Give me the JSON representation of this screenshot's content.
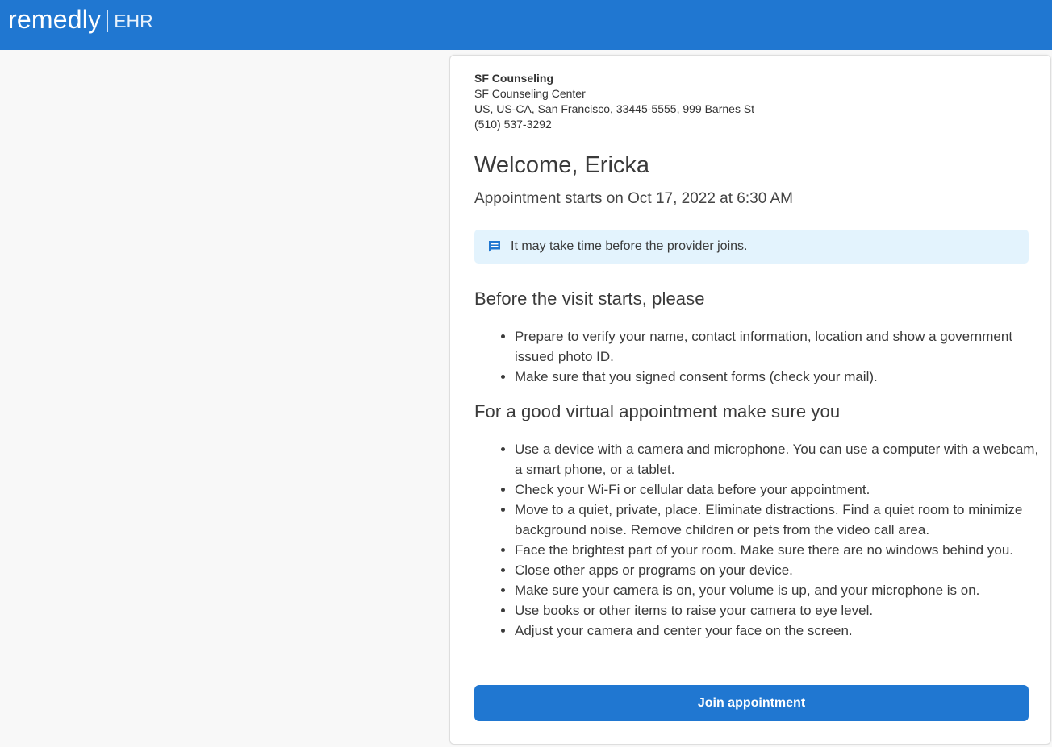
{
  "header": {
    "brand": "remedly",
    "product": "EHR"
  },
  "organization": {
    "name": "SF Counseling",
    "center": "SF Counseling Center",
    "address": "US, US-CA, San Francisco, 33445-5555, 999 Barnes St",
    "phone": "(510) 537-3292"
  },
  "welcome": "Welcome, Ericka",
  "appointment_time": "Appointment starts on Oct 17, 2022 at 6:30 AM",
  "notice": {
    "icon": "message-icon",
    "text": "It may take time before the provider joins."
  },
  "before_visit": {
    "title": "Before the visit starts, please",
    "items": [
      "Prepare to verify your name, contact information, location and show a government issued photo ID.",
      "Make sure that you signed consent forms (check your mail)."
    ]
  },
  "good_appointment": {
    "title": "For a good virtual appointment make sure you",
    "items": [
      "Use a device with a camera and microphone. You can use a computer with a webcam, a smart phone, or a tablet.",
      "Check your Wi-Fi or cellular data before your appointment.",
      "Move to a quiet, private, place. Eliminate distractions. Find a quiet room to minimize background noise. Remove children or pets from the video call area.",
      "Face the brightest part of your room. Make sure there are no windows behind you.",
      "Close other apps or programs on your device.",
      "Make sure your camera is on, your volume is up, and your microphone is on.",
      "Use books or other items to raise your camera to eye level.",
      "Adjust your camera and center your face on the screen."
    ]
  },
  "join_button": "Join appointment",
  "colors": {
    "brand_blue": "#2077d1",
    "notice_bg": "#e3f3fd"
  }
}
